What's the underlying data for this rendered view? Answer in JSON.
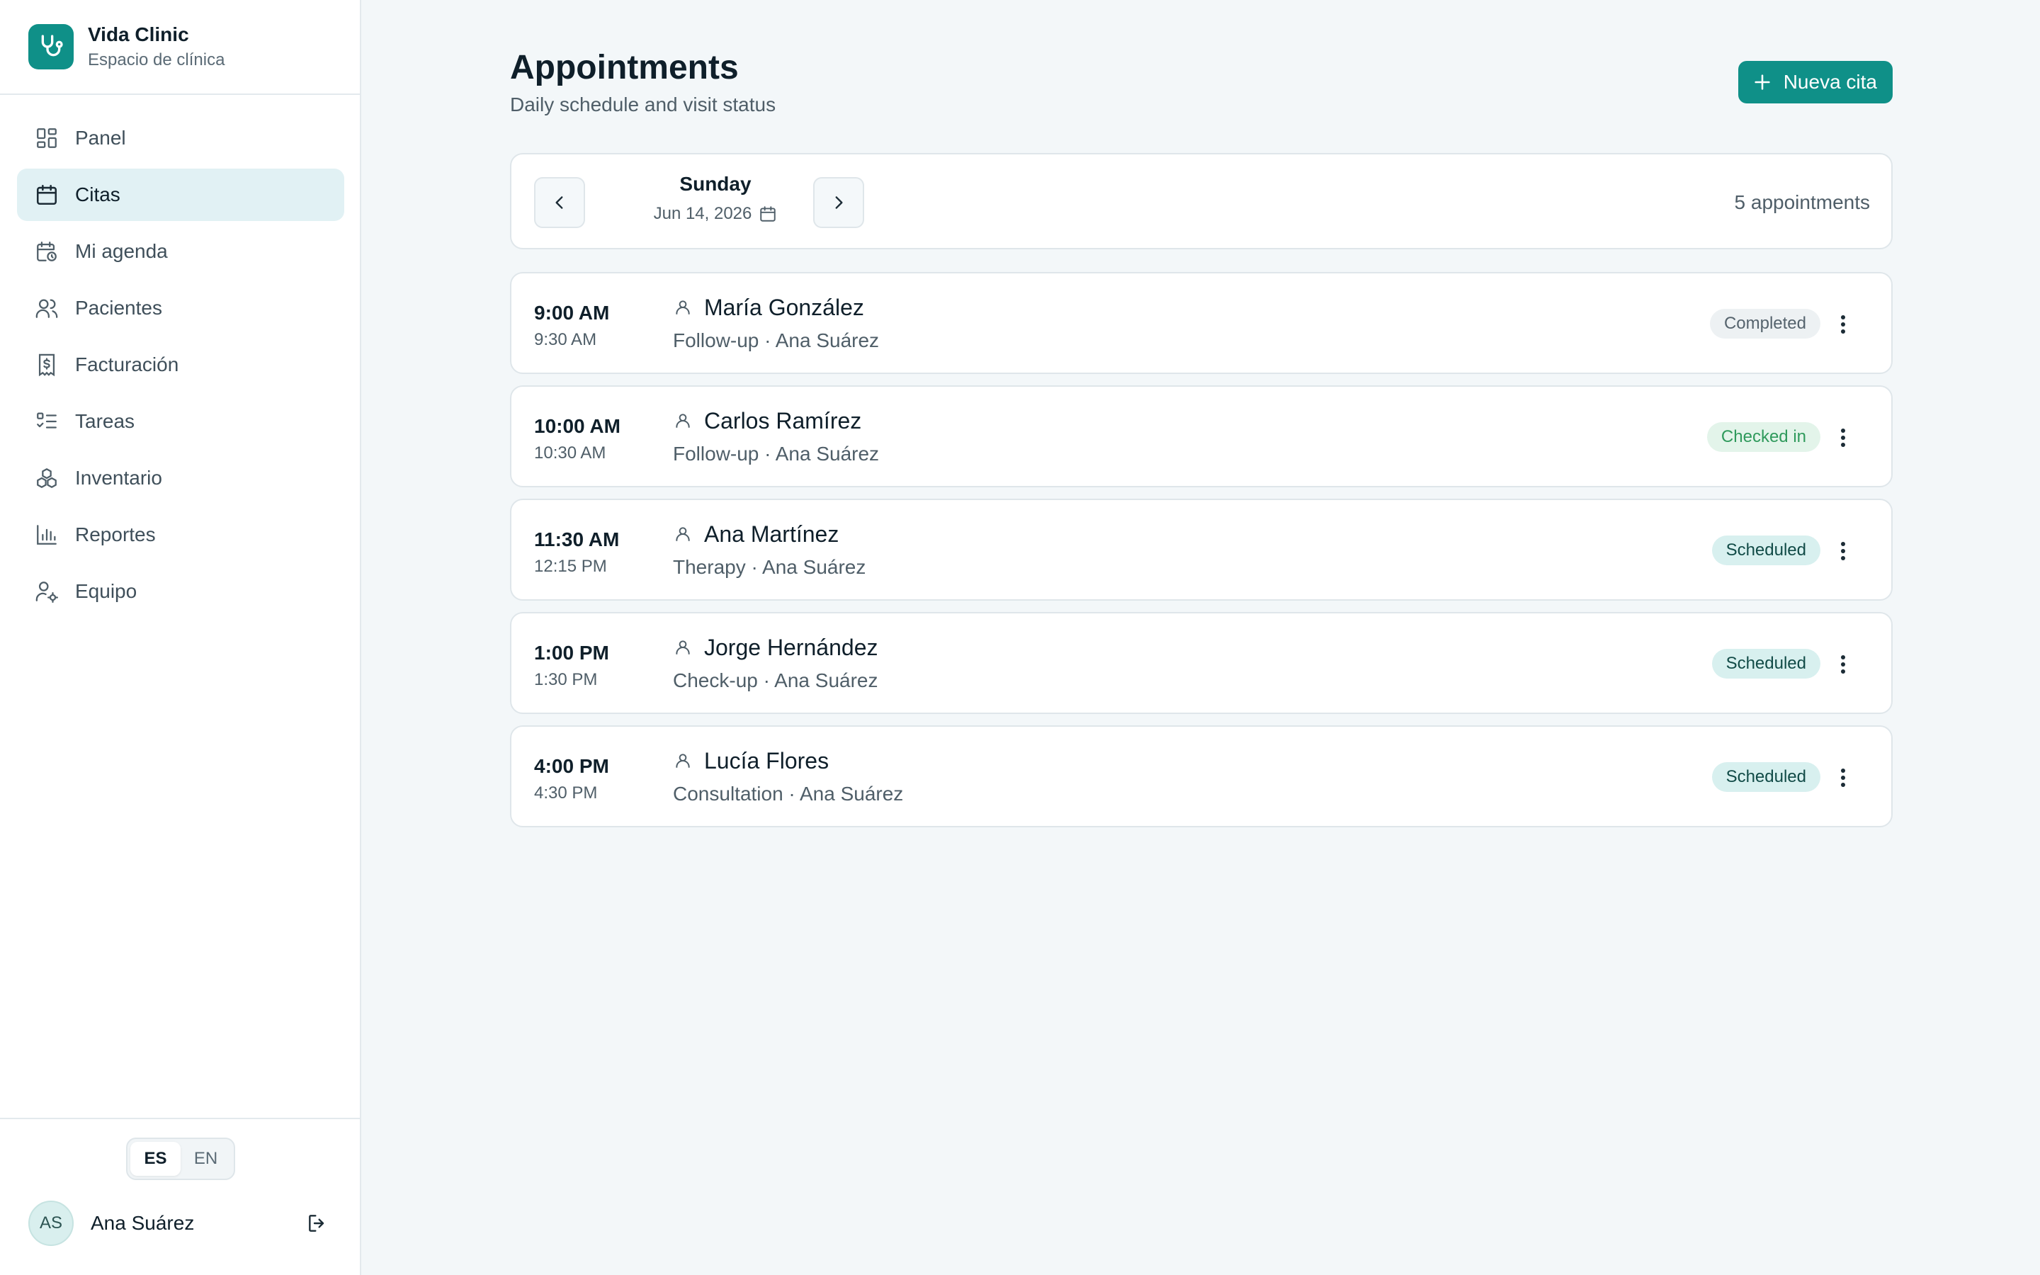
{
  "brand": {
    "name": "Vida Clinic",
    "subtitle": "Espacio de clínica"
  },
  "sidebar": {
    "items": [
      {
        "label": "Panel",
        "icon": "dashboard-icon"
      },
      {
        "label": "Citas",
        "icon": "calendar-icon",
        "active": true
      },
      {
        "label": "Mi agenda",
        "icon": "calendar-clock-icon"
      },
      {
        "label": "Pacientes",
        "icon": "users-icon"
      },
      {
        "label": "Facturación",
        "icon": "receipt-dollar-icon"
      },
      {
        "label": "Tareas",
        "icon": "task-list-icon"
      },
      {
        "label": "Inventario",
        "icon": "boxes-icon"
      },
      {
        "label": "Reportes",
        "icon": "bar-chart-icon"
      },
      {
        "label": "Equipo",
        "icon": "user-cog-icon"
      }
    ],
    "languages": [
      "ES",
      "EN"
    ],
    "active_language": "ES",
    "user": {
      "initials": "AS",
      "name": "Ana Suárez"
    }
  },
  "main": {
    "title": "Appointments",
    "subtitle": "Daily schedule and visit status",
    "new_button_label": "Nueva cita",
    "date": {
      "day": "Sunday",
      "date": "Jun 14, 2026"
    },
    "count_label": "5 appointments",
    "appointments": [
      {
        "start": "9:00 AM",
        "end": "9:30 AM",
        "patient": "María González",
        "meta": "Follow-up · Ana Suárez",
        "status": "Completed"
      },
      {
        "start": "10:00 AM",
        "end": "10:30 AM",
        "patient": "Carlos Ramírez",
        "meta": "Follow-up · Ana Suárez",
        "status": "Checked in"
      },
      {
        "start": "11:30 AM",
        "end": "12:15 PM",
        "patient": "Ana Martínez",
        "meta": "Therapy · Ana Suárez",
        "status": "Scheduled"
      },
      {
        "start": "1:00 PM",
        "end": "1:30 PM",
        "patient": "Jorge Hernández",
        "meta": "Check-up · Ana Suárez",
        "status": "Scheduled"
      },
      {
        "start": "4:00 PM",
        "end": "4:30 PM",
        "patient": "Lucía Flores",
        "meta": "Consultation · Ana Suárez",
        "status": "Scheduled"
      }
    ]
  },
  "colors": {
    "accent": "#0f9088",
    "active_nav_bg": "#e1f1f4",
    "completed": "#55636d",
    "checked_in": "#2f9a5c",
    "scheduled": "#114b47"
  }
}
